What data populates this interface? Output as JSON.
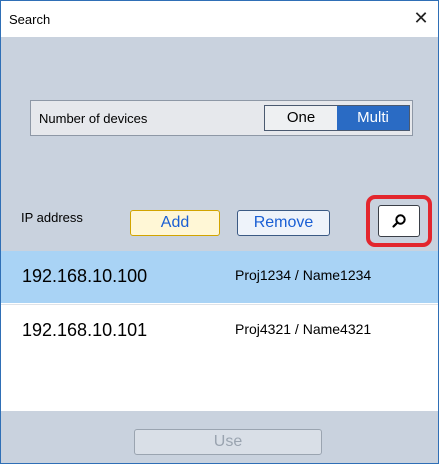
{
  "window": {
    "title": "Search",
    "close_glyph": "✕"
  },
  "devices": {
    "label": "Number of devices",
    "options": [
      "One",
      "Multi"
    ],
    "selected": "Multi"
  },
  "ip": {
    "label": "IP address",
    "add_label": "Add",
    "remove_label": "Remove",
    "search_icon": "search-icon"
  },
  "list": {
    "rows": [
      {
        "ip": "192.168.10.100",
        "name": "Proj1234 / Name1234",
        "selected": true
      },
      {
        "ip": "192.168.10.101",
        "name": "Proj4321 / Name4321",
        "selected": false
      }
    ]
  },
  "footer": {
    "use_label": "Use"
  },
  "colors": {
    "window_bg": "#c9d2de",
    "selection": "#a9d3f5",
    "segment_active": "#2a6bc4",
    "highlight": "#e3262d"
  }
}
